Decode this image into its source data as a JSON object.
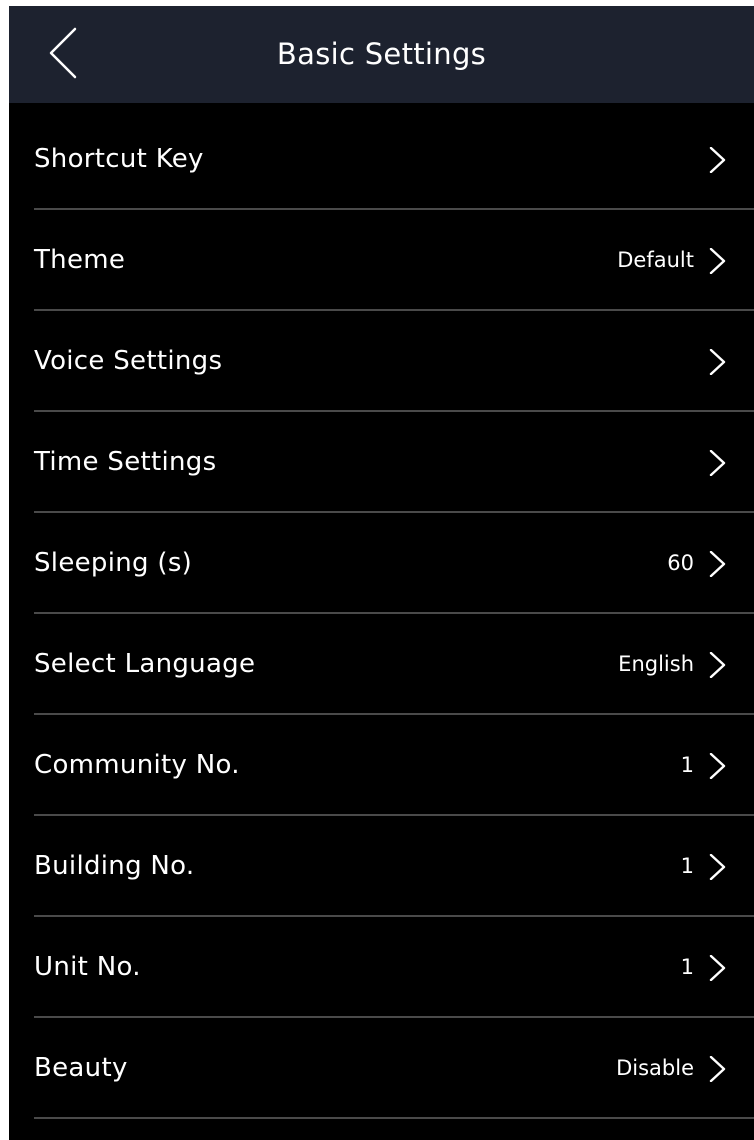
{
  "header": {
    "title": "Basic Settings",
    "back_icon": "chevron-left-icon"
  },
  "settings": {
    "items": [
      {
        "label": "Shortcut Key",
        "value": ""
      },
      {
        "label": "Theme",
        "value": "Default"
      },
      {
        "label": "Voice Settings",
        "value": ""
      },
      {
        "label": "Time Settings",
        "value": ""
      },
      {
        "label": "Sleeping (s)",
        "value": "60"
      },
      {
        "label": "Select Language",
        "value": "English"
      },
      {
        "label": "Community No.",
        "value": "1"
      },
      {
        "label": "Building No.",
        "value": "1"
      },
      {
        "label": "Unit No.",
        "value": "1"
      },
      {
        "label": "Beauty",
        "value": "Disable"
      }
    ],
    "row_icon": "chevron-right-icon"
  },
  "colors": {
    "header_bg": "#1d222f",
    "screen_bg": "#000000",
    "text": "#ffffff",
    "divider": "#4a4a4a"
  }
}
